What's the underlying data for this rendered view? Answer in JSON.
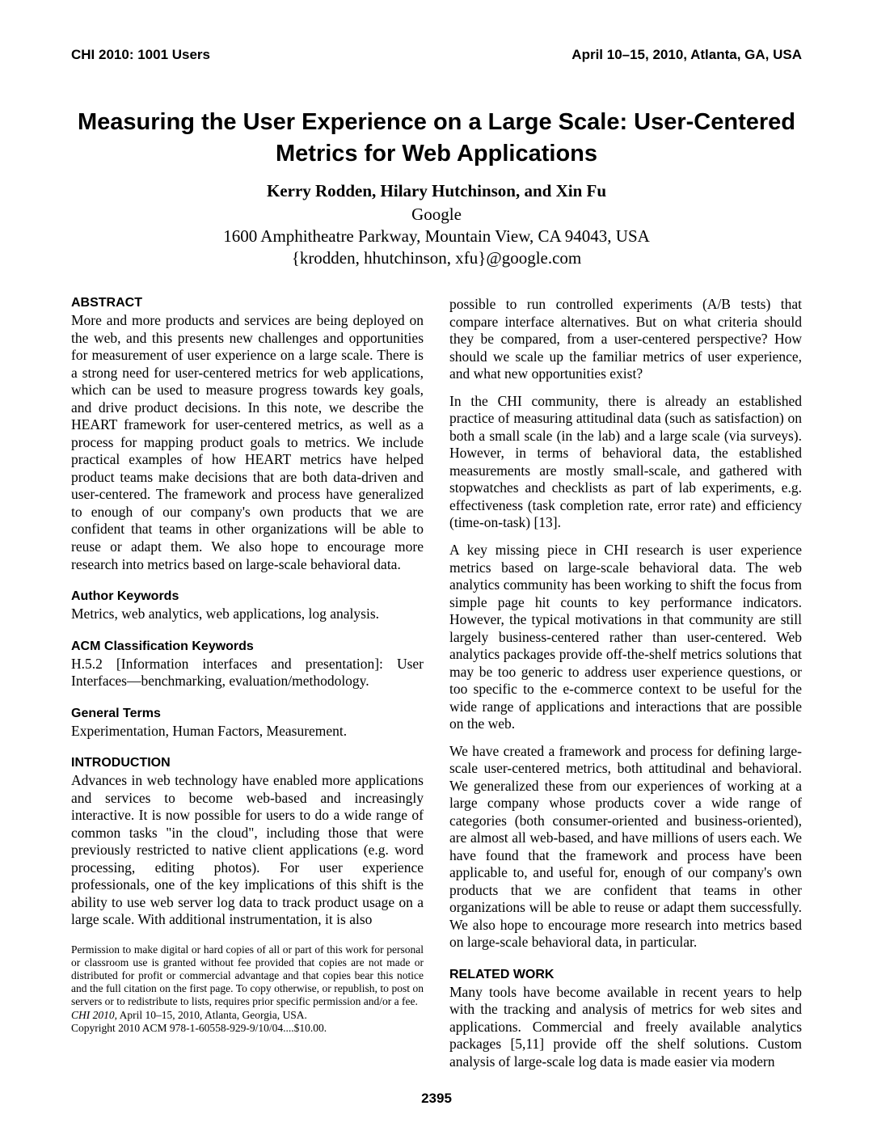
{
  "header": {
    "left": "CHI 2010: 1001 Users",
    "right": "April 10–15, 2010, Atlanta, GA, USA"
  },
  "title": "Measuring the User Experience on a Large Scale: User-Centered Metrics for Web Applications",
  "authors": "Kerry Rodden, Hilary Hutchinson, and Xin Fu",
  "affiliation": "Google",
  "address": "1600 Amphitheatre Parkway, Mountain View, CA 94043, USA",
  "email": "{krodden, hhutchinson, xfu}@google.com",
  "sections": {
    "abstract_heading": "ABSTRACT",
    "abstract_text": "More and more products and services are being deployed on the web, and this presents new challenges and opportunities for measurement of user experience on a large scale.  There is a strong need for user-centered metrics for web applications, which can be used to measure progress towards key goals, and drive product decisions.  In this note, we describe the HEART framework for user-centered metrics, as well as a process for mapping product goals to metrics. We include practical examples of how HEART metrics have helped product teams make decisions that are both data-driven and user-centered.  The framework and process have generalized to enough of our company's own products that we are confident that teams in other organizations will be able to reuse or adapt them. We also hope to encourage more research into metrics based on large-scale behavioral data.",
    "author_keywords_heading": "Author Keywords",
    "author_keywords_text": "Metrics, web analytics, web applications, log analysis.",
    "acm_heading": "ACM Classification Keywords",
    "acm_text": "H.5.2 [Information interfaces and presentation]: User Interfaces—benchmarking, evaluation/methodology.",
    "general_terms_heading": "General Terms",
    "general_terms_text": "Experimentation, Human Factors, Measurement.",
    "intro_heading": "INTRODUCTION",
    "intro_p1": "Advances in web technology have enabled more applications and services to become web-based and increasingly interactive. It is now possible for users to do a wide range of common tasks \"in the cloud\", including those that were previously restricted to native client applications (e.g. word processing, editing photos). For user experience professionals, one of the key implications of this shift is the ability to use web server log data to track product usage on a large scale.  With additional instrumentation, it is also",
    "permission_text": "Permission to make digital or hard copies of all or part of this work for personal or classroom use is granted without fee provided that copies are not made or distributed for profit or commercial advantage and that copies bear this notice and the full citation on the first page. To copy otherwise, or republish, to post on servers or to redistribute to lists, requires prior specific permission and/or a fee.",
    "permission_venue_ital": "CHI 2010",
    "permission_venue_rest": ", April 10–15, 2010, Atlanta, Georgia, USA.",
    "permission_copyright": "Copyright 2010 ACM  978-1-60558-929-9/10/04....$10.00.",
    "col2_p1": "possible to run controlled experiments (A/B tests) that compare interface alternatives.  But on what criteria should they be compared, from a user-centered perspective?  How should we scale up the familiar metrics of user experience, and what new opportunities exist?",
    "col2_p2": "In the CHI community, there is already an established practice of measuring attitudinal data (such as satisfaction) on both a small scale (in the lab) and a large scale (via surveys). However, in terms of behavioral data, the established measurements are mostly small-scale, and gathered with stopwatches and checklists as part of lab experiments, e.g. effectiveness (task completion rate, error rate) and efficiency (time-on-task) [13].",
    "col2_p3": "A key missing piece in CHI research is user experience metrics based on large-scale behavioral data.  The web analytics community has been working to shift the focus from simple page hit counts to key performance indicators.  However, the typical motivations in that community are still largely business-centered rather than user-centered. Web analytics packages provide off-the-shelf metrics solutions that may be too generic to address user experience questions, or too specific to the e-commerce context to be useful for the wide range of applications and interactions that are possible on the web.",
    "col2_p4": "We have created a framework and process for defining large-scale user-centered metrics, both attitudinal and behavioral. We generalized these from our experiences of working at a large company whose products cover a wide range of categories (both consumer-oriented and business-oriented), are almost all web-based, and have millions of users each.  We have found that the framework and process have been applicable to, and useful for, enough of our company's own products that we are confident that teams in other organizations will be able to reuse or adapt them successfully. We also hope to encourage more research into metrics based on large-scale behavioral data, in particular.",
    "related_heading": "RELATED WORK",
    "related_p1": "Many tools have become available in recent years to help with the tracking and analysis of metrics for web sites and applications. Commercial and freely available analytics packages [5,11] provide off the shelf solutions. Custom analysis of large-scale log data is made easier via modern"
  },
  "page_number": "2395"
}
